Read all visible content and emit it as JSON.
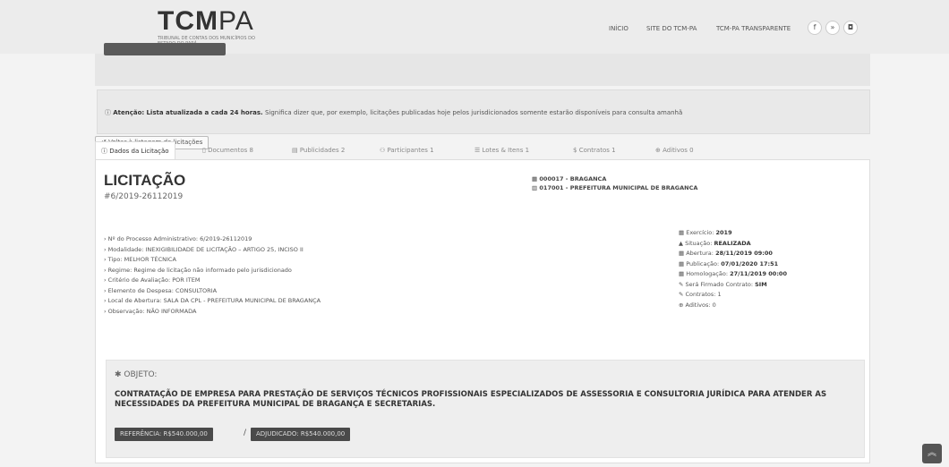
{
  "header": {
    "logo_bold": "TCM",
    "logo_light": "PA",
    "logo_subtitle": "TRIBUNAL DE CONTAS DOS MUNICÍPIOS DO ESTADO DO PARÁ",
    "nav": [
      "INÍCIO",
      "SITE DO TCM-PA",
      "TCM-PA TRANSPARENTE"
    ],
    "social": [
      "f",
      "»",
      "◘"
    ]
  },
  "attention": {
    "strong": "Atenção:",
    "bold_text": "Lista atualizada a cada 24 horas.",
    "text": "Significa dizer que, por exemplo, licitações publicadas hoje pelos jurisdicionados somente estarão disponíveis para consulta amanhã"
  },
  "back_button": "Voltar à listagem de licitações",
  "tabs": [
    {
      "label": "Dados da Licitação"
    },
    {
      "label": "Documentos  8"
    },
    {
      "label": "Publicidades  2"
    },
    {
      "label": "Participantes  1"
    },
    {
      "label": "Lotes & Itens  1"
    },
    {
      "label": "Contratos  1"
    },
    {
      "label": "Aditivos  0"
    }
  ],
  "licitacao": {
    "title": "LICITAÇÃO",
    "number": "#6/2019-26112019",
    "entity_code": "000017 - BRAGANCA",
    "entity_name": "017001 - PREFEITURA MUNICIPAL DE BRAGANCA"
  },
  "details": [
    "› Nº do Processo Administrativo: 6/2019-26112019",
    "› Modalidade: INEXIGIBILIDADE DE LICITAÇÃO – ARTIGO 25, INCISO II",
    "› Tipo: MELHOR TÉCNICA",
    "› Regime: Regime de licitação não informado pelo jurisdicionado",
    "› Critério de Avaliação: POR ITEM",
    "› Elemento de Despesa: CONSULTORIA",
    "› Local de Abertura: SALA DA CPL - PREFEITURA MUNICIPAL DE BRAGANÇA",
    "› Observação: NÃO INFORMADA"
  ],
  "info": [
    {
      "label": "Exercício:",
      "value": "2019"
    },
    {
      "label": "Situação:",
      "value": "REALIZADA"
    },
    {
      "label": "Abertura:",
      "value": "28/11/2019 09:00"
    },
    {
      "label": "Publicação:",
      "value": "07/01/2020 17:51"
    },
    {
      "label": "Homologação:",
      "value": "27/11/2019 00:00"
    },
    {
      "label": "Será Firmado Contrato:",
      "value": "SIM"
    },
    {
      "label": "Contratos:",
      "value": "1"
    },
    {
      "label": "Aditivos:",
      "value": "0"
    }
  ],
  "objeto": {
    "label": "OBJETO:",
    "text": "CONTRATAÇÃO DE EMPRESA PARA PRESTAÇÃO DE SERVIÇOS TÉCNICOS PROFISSIONAIS ESPECIALIZADOS DE ASSESSORIA E CONSULTORIA JURÍDICA PARA ATENDER AS NECESSIDADES DA PREFEITURA MUNICIPAL DE BRAGANÇA E SECRETARIAS.",
    "referencia": "REFERÊNCIA: R$540.000,00",
    "separator": "/",
    "adjudicado": "ADJUDICADO: R$540.000,00"
  },
  "scroll_top": "︽"
}
